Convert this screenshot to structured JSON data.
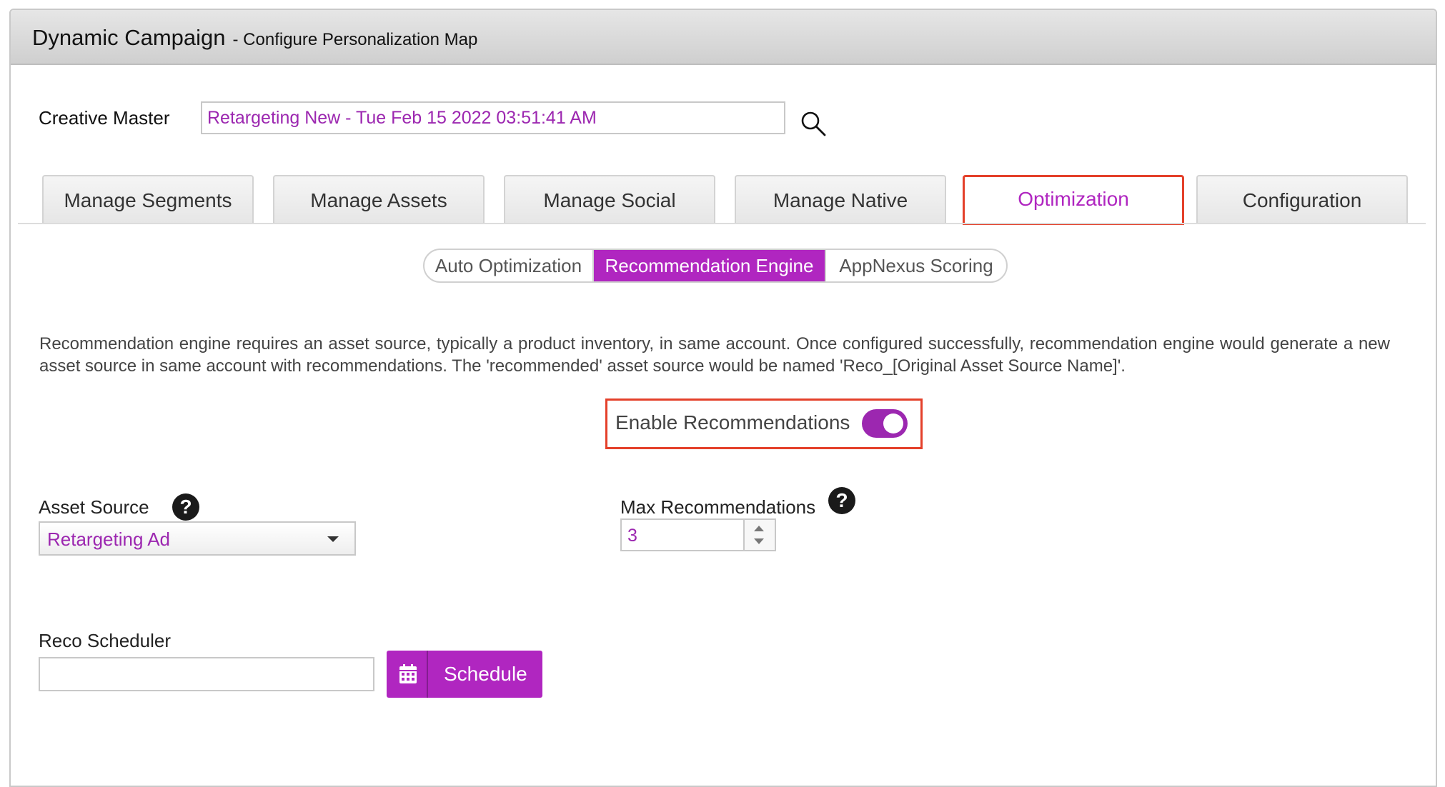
{
  "window": {
    "title": "Dynamic Campaign",
    "subtitle": "- Configure Personalization Map"
  },
  "creative_master": {
    "label": "Creative Master",
    "value": "Retargeting New - Tue Feb 15 2022 03:51:41 AM",
    "search_icon": "search-icon"
  },
  "tabs": [
    {
      "label": "Manage Segments",
      "active": false
    },
    {
      "label": "Manage Assets",
      "active": false
    },
    {
      "label": "Manage Social",
      "active": false
    },
    {
      "label": "Manage Native",
      "active": false
    },
    {
      "label": "Optimization",
      "active": true
    },
    {
      "label": "Configuration",
      "active": false
    }
  ],
  "subtabs": [
    {
      "label": "Auto Optimization",
      "active": false
    },
    {
      "label": "Recommendation Engine",
      "active": true
    },
    {
      "label": "AppNexus Scoring",
      "active": false
    }
  ],
  "description": "Recommendation engine requires an asset source, typically a product inventory, in same account. Once configured successfully, recommendation engine would generate a new asset source in same account with recommendations. The 'recommended' asset source would be named 'Reco_[Original Asset Source Name]'.",
  "enable": {
    "label": "Enable Recommendations",
    "enabled": true
  },
  "asset_source": {
    "label": "Asset Source",
    "help": "?",
    "selected": "Retargeting Ad"
  },
  "max_recommendations": {
    "label": "Max Recommendations",
    "help": "?",
    "value": "3"
  },
  "reco_scheduler": {
    "label": "Reco Scheduler",
    "value": "",
    "button_label": "Schedule",
    "button_icon": "calendar-icon"
  },
  "colors": {
    "accent": "#b026c0",
    "highlight_border": "#e4402a",
    "toggle_on": "#9c27b0"
  }
}
